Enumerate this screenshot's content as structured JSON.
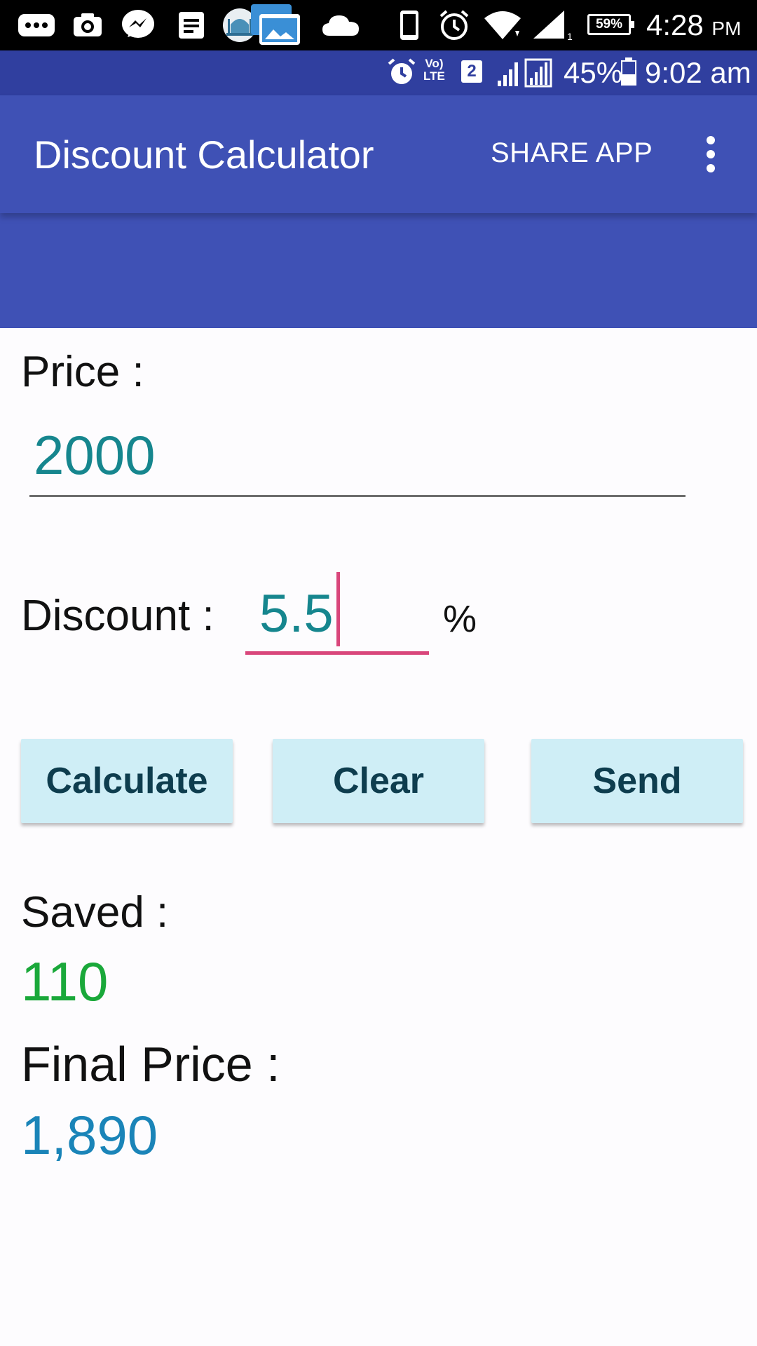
{
  "system_status": {
    "battery_percent": "59%",
    "time": "4:28",
    "ampm": "PM"
  },
  "inner_status": {
    "lte": "Vo) LTE",
    "lte_top": "Vo)",
    "lte_bottom": "LTE",
    "sim": "2",
    "battery_percent": "45%",
    "battery_level": 0.45,
    "time": "9:02 am"
  },
  "app_bar": {
    "title": "Discount Calculator",
    "share_label": "SHARE APP",
    "color": "#3f51b5"
  },
  "form": {
    "price_label": "Price  :",
    "price_value": "2000",
    "discount_label": "Discount  :",
    "discount_value": "5.5",
    "percent_symbol": "%"
  },
  "buttons": {
    "calculate": "Calculate",
    "clear": "Clear",
    "send": "Send",
    "color": "#cfeef6"
  },
  "results": {
    "saved_label": "Saved :",
    "saved_value": "110",
    "final_label": "Final Price :",
    "final_value": "1,890"
  },
  "icons": {
    "notification_icons": [
      "messages-icon",
      "camera-icon",
      "messenger-icon",
      "notes-icon",
      "mosque-app-icon",
      "gallery-icon",
      "cloud-icon"
    ],
    "status_icons": [
      "phone-icon",
      "alarm-icon",
      "wifi-icon",
      "signal-icon"
    ]
  },
  "colors": {
    "accent": "#d9467b",
    "input_text": "#16868e",
    "saved": "#1aa83a",
    "final": "#1a84b8"
  }
}
